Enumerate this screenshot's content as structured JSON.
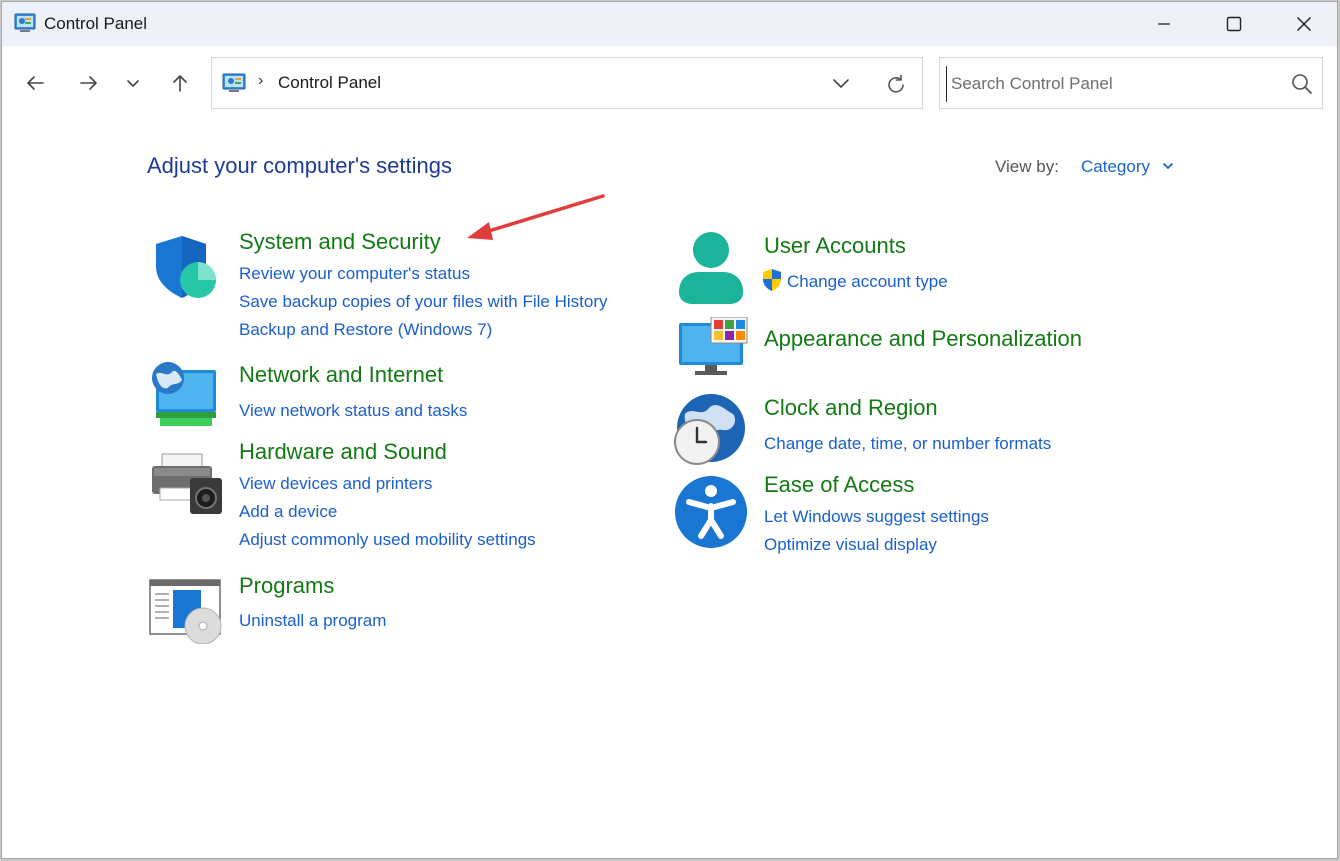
{
  "window": {
    "title": "Control Panel",
    "minimize_icon": "minimize-icon",
    "maximize_icon": "maximize-icon",
    "close_icon": "close-icon"
  },
  "nav": {
    "back_icon": "back-arrow-icon",
    "forward_icon": "forward-arrow-icon",
    "recent_icon": "chevron-down-icon",
    "up_icon": "up-arrow-icon"
  },
  "address": {
    "separator": "›",
    "path": "Control Panel"
  },
  "search": {
    "placeholder": "Search Control Panel",
    "value": ""
  },
  "content": {
    "heading": "Adjust your computer's settings",
    "view_by_label": "View by:",
    "view_by_value": "Category"
  },
  "left_categories": [
    {
      "title": "System and Security",
      "icon": "shield-icon",
      "links": [
        "Review your computer's status",
        "Save backup copies of your files with File History",
        "Backup and Restore (Windows 7)"
      ]
    },
    {
      "title": "Network and Internet",
      "icon": "network-globe-icon",
      "links": [
        "View network status and tasks"
      ]
    },
    {
      "title": "Hardware and Sound",
      "icon": "printer-speaker-icon",
      "links": [
        "View devices and printers",
        "Add a device",
        "Adjust commonly used mobility settings"
      ]
    },
    {
      "title": "Programs",
      "icon": "programs-disc-icon",
      "links": [
        "Uninstall a program"
      ]
    }
  ],
  "right_categories": [
    {
      "title": "User Accounts",
      "icon": "user-icon",
      "links": [
        "Change account type"
      ]
    },
    {
      "title": "Appearance and Personalization",
      "icon": "monitor-personalize-icon",
      "links": []
    },
    {
      "title": "Clock and Region",
      "icon": "globe-clock-icon",
      "links": [
        "Change date, time, or number formats"
      ]
    },
    {
      "title": "Ease of Access",
      "icon": "accessibility-icon",
      "links": [
        "Let Windows suggest settings",
        "Optimize visual display"
      ]
    }
  ],
  "colors": {
    "title_bar": "#eef1f8",
    "heading": "#1e3b95",
    "category_title": "#137a13",
    "link": "#1a5fcf",
    "annotation_arrow": "#e03c3c"
  }
}
